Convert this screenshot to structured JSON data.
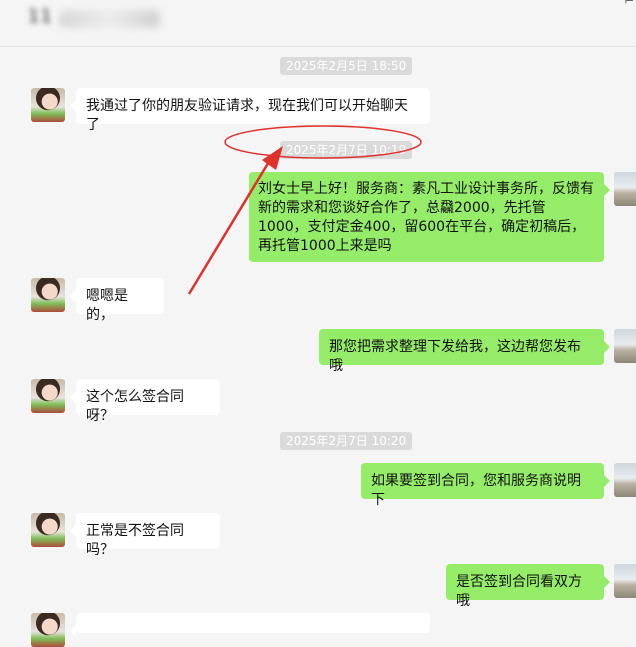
{
  "header": {
    "title": "11 …",
    "icons": [
      "pin-icon",
      "more-icon"
    ]
  },
  "colors": {
    "outgoing_bubble": "#95ec69",
    "incoming_bubble": "#ffffff",
    "timestamp_bg": "#dadada",
    "annotation": "#e0302a"
  },
  "messages": {
    "ts1": "2025年2月5日 18:50",
    "m1": "我通过了你的朋友验证请求，现在我们可以开始聊天了",
    "ts2": "2025年2月7日 10:19",
    "m2": "刘女士早上好！服务商：素凡工业设计事务所，反馈有新的需求和您谈好合作了，总飝2000，先托管1000，支付定金400，留600在平台，确定初稿后，再托管1000上来是吗",
    "m3": "嗯嗯是的，",
    "m4": "那您把需求整理下发给我，这边帮您发布哦",
    "m5": "这个怎么签合同呀？",
    "ts3": "2025年2月7日 10:20",
    "m6": "如果要签到合同，您和服务商说明下",
    "m7": "正常是不签合同吗？",
    "m8": "是否签到合同看双方哦"
  }
}
